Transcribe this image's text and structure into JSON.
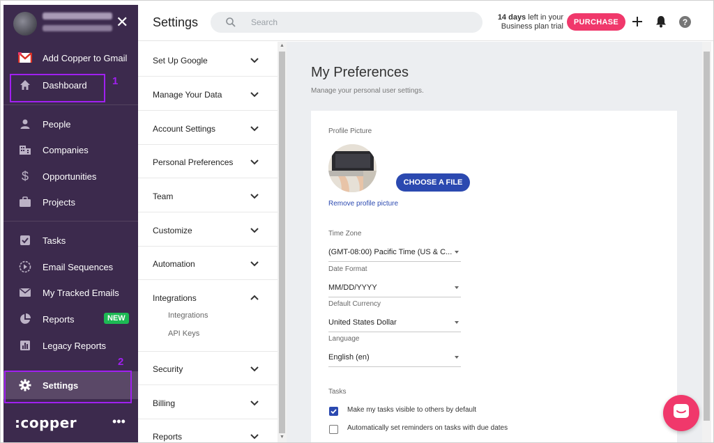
{
  "sidebar": {
    "gmail_label": "Add Copper to Gmail",
    "items": [
      {
        "label": "Dashboard",
        "icon": "home-icon"
      },
      {
        "label": "People",
        "icon": "person-icon"
      },
      {
        "label": "Companies",
        "icon": "building-icon"
      },
      {
        "label": "Opportunities",
        "icon": "dollar-icon"
      },
      {
        "label": "Projects",
        "icon": "briefcase-icon"
      },
      {
        "label": "Tasks",
        "icon": "checkbox-icon"
      },
      {
        "label": "Email Sequences",
        "icon": "play-circle-icon"
      },
      {
        "label": "My Tracked Emails",
        "icon": "envelope-icon"
      },
      {
        "label": "Reports",
        "icon": "pie-chart-icon",
        "badge": "NEW"
      },
      {
        "label": "Legacy Reports",
        "icon": "bar-chart-icon"
      },
      {
        "label": "Settings",
        "icon": "gear-icon"
      }
    ],
    "logo": ":copper",
    "more": "•••"
  },
  "annotations": {
    "one": "1",
    "two": "2",
    "color": "#a020f0"
  },
  "topbar": {
    "title": "Settings",
    "search_placeholder": "Search",
    "trial_days": "14 days",
    "trial_rest": " left in your",
    "trial_line2": "Business plan trial",
    "purchase_label": "PURCHASE"
  },
  "settings_nav": {
    "sections": [
      {
        "label": "Set Up Google",
        "expanded": false
      },
      {
        "label": "Manage Your Data",
        "expanded": false
      },
      {
        "label": "Account Settings",
        "expanded": false
      },
      {
        "label": "Personal Preferences",
        "expanded": false
      },
      {
        "label": "Team",
        "expanded": false
      },
      {
        "label": "Customize",
        "expanded": false
      },
      {
        "label": "Automation",
        "expanded": false
      },
      {
        "label": "Integrations",
        "expanded": true,
        "children": [
          "Integrations",
          "API Keys"
        ]
      },
      {
        "label": "Security",
        "expanded": false
      },
      {
        "label": "Billing",
        "expanded": false
      },
      {
        "label": "Reports",
        "expanded": false
      }
    ]
  },
  "main": {
    "title": "My Preferences",
    "subtitle": "Manage your personal user settings.",
    "profile_label": "Profile Picture",
    "choose_label": "CHOOSE A FILE",
    "remove_label": "Remove profile picture",
    "timezone_label": "Time Zone",
    "timezone_value": "(GMT-08:00) Pacific Time (US & C...",
    "date_label": "Date Format",
    "date_value": "MM/DD/YYYY",
    "currency_label": "Default Currency",
    "currency_value": "United States Dollar",
    "language_label": "Language",
    "language_value": "English (en)",
    "tasks_label": "Tasks",
    "tasks_opt1": "Make my tasks visible to others by default",
    "tasks_opt1_checked": true,
    "tasks_opt2": "Automatically set reminders on tasks with due dates",
    "tasks_opt2_checked": false
  },
  "colors": {
    "sidebar_bg": "#3c2a4d",
    "accent_pink": "#f0386b",
    "primary_blue": "#2b49b0",
    "new_badge": "#1db954"
  }
}
